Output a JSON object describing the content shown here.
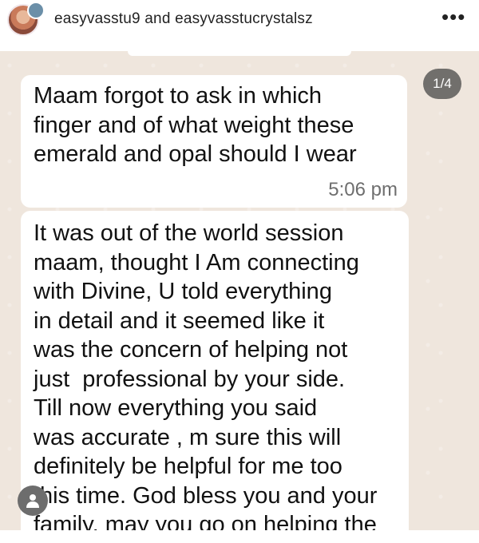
{
  "header": {
    "username": "easyvasstu9 and easyvasstucrystalsz",
    "more_icon": "more-horizontal-icon"
  },
  "post": {
    "counter": "1/4",
    "messages": [
      {
        "text": "Maam forgot to ask in which\nfinger and of what weight these\nemerald and opal should I wear",
        "time": "5:06 pm"
      },
      {
        "text": "It was out of the world session\nmaam, thought I Am connecting\nwith Divine, U told everything\nin detail and it seemed like it\nwas the concern of helping not\njust  professional by your side.\nTill now everything you said\nwas accurate , m sure this will\ndefinitely be helpful for me too\nthis time. God bless you and your\nfamily, may you go on helping the"
      }
    ]
  },
  "colors": {
    "chat_background": "#efe6dd",
    "bubble": "#ffffff",
    "counter_badge": "#4a4a4a"
  }
}
